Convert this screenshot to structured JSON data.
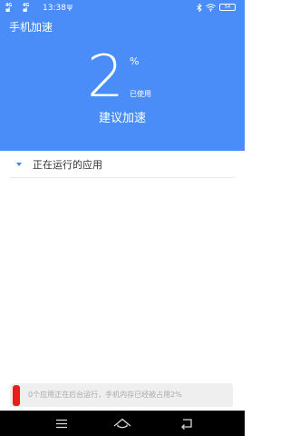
{
  "status_bar": {
    "signal_1": "4G",
    "signal_2": "4G",
    "time": "13:38",
    "usb_icon": "usb-icon",
    "bluetooth_icon": "bluetooth-icon",
    "wifi_icon": "wifi-icon",
    "battery_level": "54"
  },
  "header": {
    "title": "手机加速",
    "percent_value": "2",
    "percent_sign": "%",
    "used_label": "已使用",
    "suggest_label": "建议加速",
    "background_color": "#4a8df8"
  },
  "section": {
    "label": "正在运行的应用",
    "expanded": true
  },
  "toast": {
    "text": "0个应用正在后台运行，手机内存已经被占用2%",
    "accent_color": "#ee1b1b"
  },
  "nav_bar": {
    "menu_icon": "menu-icon",
    "home_icon": "home-icon",
    "back_icon": "back-icon"
  }
}
